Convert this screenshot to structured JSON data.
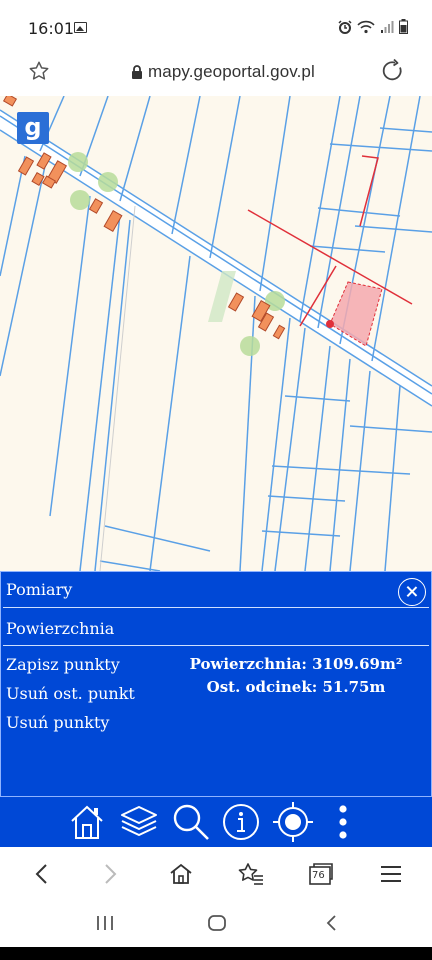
{
  "status": {
    "time": "16:01"
  },
  "browser": {
    "url": "mapy.geoportal.gov.pl",
    "tab_count": "76"
  },
  "map": {
    "logo_letter": "g",
    "colors": {
      "background": "#fdf8ed",
      "parcel_line": "#5aa0e6",
      "road_fill": "#ffffff",
      "measure_line": "#e0303a",
      "measure_fill": "#f4a9ae",
      "tree": "#b8dc9a",
      "building": "#f2915c"
    }
  },
  "panel": {
    "title": "Pomiary",
    "subtitle": "Powierzchnia",
    "actions": [
      {
        "label": "Zapisz punkty"
      },
      {
        "label": "Usuń ost. punkt"
      },
      {
        "label": "Usuń punkty"
      }
    ],
    "area_text": "Powierzchnia: 3109.69m²",
    "segment_text": "Ost. odcinek: 51.75m",
    "color": "#0048d6"
  },
  "toolbar": {
    "items": [
      "home-icon",
      "layers-icon",
      "search-icon",
      "info-icon",
      "locate-icon",
      "more-icon"
    ]
  }
}
